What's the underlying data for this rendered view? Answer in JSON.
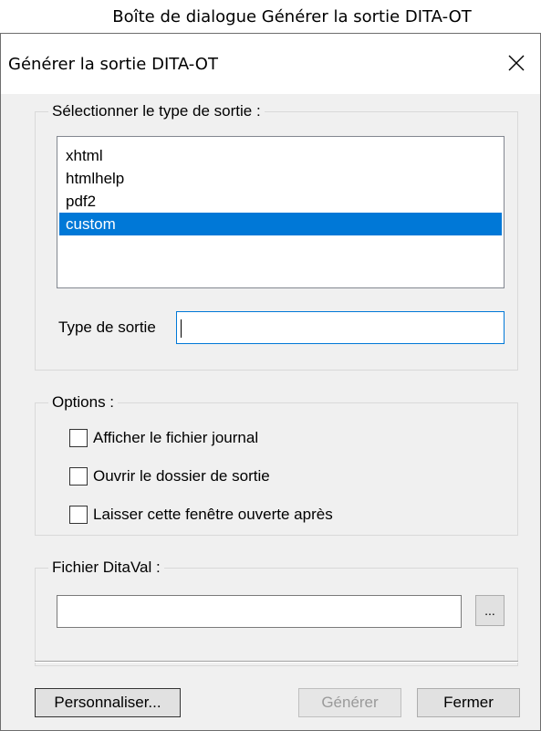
{
  "caption": "Boîte de dialogue Générer la sortie DITA-OT",
  "window": {
    "title": "Générer la sortie DITA-OT",
    "close_icon": "close-icon"
  },
  "output_type": {
    "group_label": "Sélectionner le type de sortie :",
    "items": [
      {
        "label": "xhtml",
        "selected": false
      },
      {
        "label": "htmlhelp",
        "selected": false
      },
      {
        "label": "pdf2",
        "selected": false
      },
      {
        "label": "custom",
        "selected": true
      }
    ],
    "type_label": "Type de sortie",
    "type_value": ""
  },
  "options": {
    "group_label": "Options :",
    "checkboxes": [
      {
        "label": "Afficher le fichier journal",
        "checked": false
      },
      {
        "label": "Ouvrir le dossier de sortie",
        "checked": false
      },
      {
        "label": "Laisser cette fenêtre ouverte après",
        "checked": false
      }
    ]
  },
  "ditaval": {
    "group_label": "Fichier DitaVal :",
    "value": "",
    "browse_label": "..."
  },
  "buttons": {
    "customize": "Personnaliser...",
    "generate": "Générer",
    "close": "Fermer"
  },
  "colors": {
    "selection": "#0078d7",
    "dialog_bg": "#f0f0f0",
    "focus_border": "#0078d7"
  }
}
